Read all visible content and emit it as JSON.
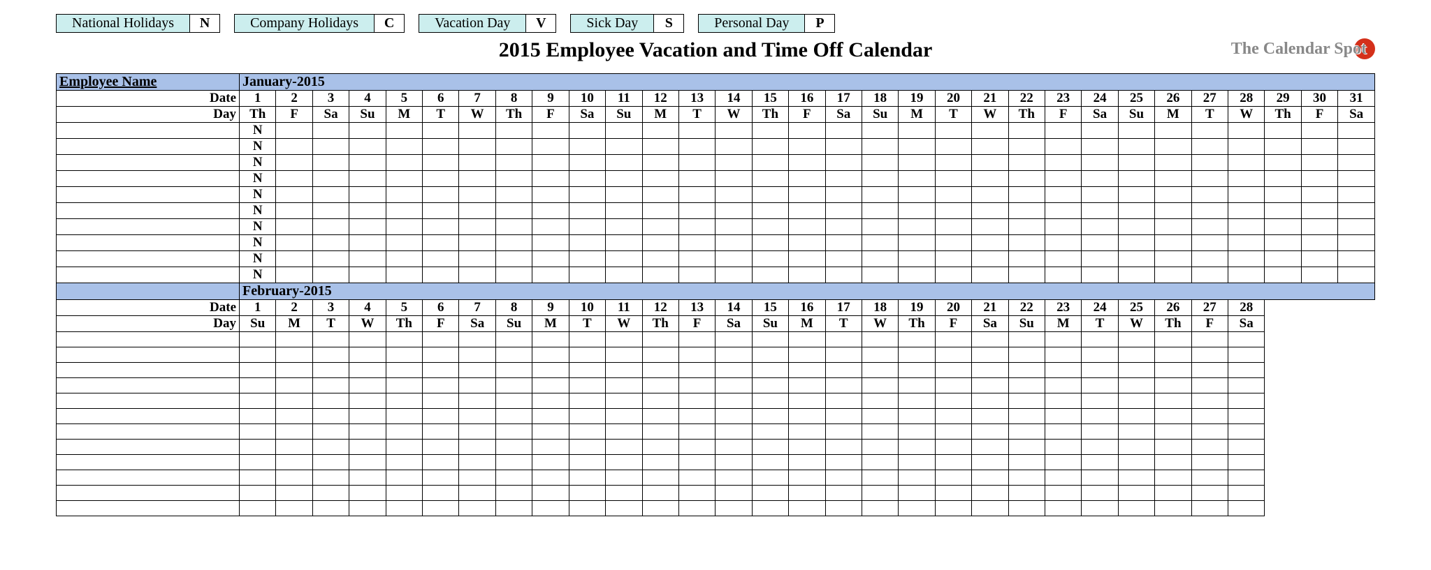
{
  "legend": [
    {
      "label": "National Holidays",
      "code": "N"
    },
    {
      "label": "Company Holidays",
      "code": "C"
    },
    {
      "label": "Vacation Day",
      "code": "V"
    },
    {
      "label": "Sick Day",
      "code": "S"
    },
    {
      "label": "Personal Day",
      "code": "P"
    }
  ],
  "title": "2015 Employee Vacation and Time Off Calendar",
  "brand": "The Calendar Spot",
  "emp_header": "Employee Name",
  "row_date": "Date",
  "row_day": "Day",
  "months": [
    {
      "name": "January-2015",
      "num_days": 31,
      "dates": [
        "1",
        "2",
        "3",
        "4",
        "5",
        "6",
        "7",
        "8",
        "9",
        "10",
        "11",
        "12",
        "13",
        "14",
        "15",
        "16",
        "17",
        "18",
        "19",
        "20",
        "21",
        "22",
        "23",
        "24",
        "25",
        "26",
        "27",
        "28",
        "29",
        "30",
        "31"
      ],
      "days": [
        "Th",
        "F",
        "Sa",
        "Su",
        "M",
        "T",
        "W",
        "Th",
        "F",
        "Sa",
        "Su",
        "M",
        "T",
        "W",
        "Th",
        "F",
        "Sa",
        "Su",
        "M",
        "T",
        "W",
        "Th",
        "F",
        "Sa",
        "Su",
        "M",
        "T",
        "W",
        "Th",
        "F",
        "Sa"
      ],
      "employees": [
        {
          "name": "",
          "entries": [
            "N",
            "",
            "",
            "",
            "",
            "",
            "",
            "",
            "",
            "",
            "",
            "",
            "",
            "",
            "",
            "",
            "",
            "",
            "",
            "",
            "",
            "",
            "",
            "",
            "",
            "",
            "",
            "",
            "",
            "",
            ""
          ]
        },
        {
          "name": "",
          "entries": [
            "N",
            "",
            "",
            "",
            "",
            "",
            "",
            "",
            "",
            "",
            "",
            "",
            "",
            "",
            "",
            "",
            "",
            "",
            "",
            "",
            "",
            "",
            "",
            "",
            "",
            "",
            "",
            "",
            "",
            "",
            ""
          ]
        },
        {
          "name": "",
          "entries": [
            "N",
            "",
            "",
            "",
            "",
            "",
            "",
            "",
            "",
            "",
            "",
            "",
            "",
            "",
            "",
            "",
            "",
            "",
            "",
            "",
            "",
            "",
            "",
            "",
            "",
            "",
            "",
            "",
            "",
            "",
            ""
          ]
        },
        {
          "name": "",
          "entries": [
            "N",
            "",
            "",
            "",
            "",
            "",
            "",
            "",
            "",
            "",
            "",
            "",
            "",
            "",
            "",
            "",
            "",
            "",
            "",
            "",
            "",
            "",
            "",
            "",
            "",
            "",
            "",
            "",
            "",
            "",
            ""
          ]
        },
        {
          "name": "",
          "entries": [
            "N",
            "",
            "",
            "",
            "",
            "",
            "",
            "",
            "",
            "",
            "",
            "",
            "",
            "",
            "",
            "",
            "",
            "",
            "",
            "",
            "",
            "",
            "",
            "",
            "",
            "",
            "",
            "",
            "",
            "",
            ""
          ]
        },
        {
          "name": "",
          "entries": [
            "N",
            "",
            "",
            "",
            "",
            "",
            "",
            "",
            "",
            "",
            "",
            "",
            "",
            "",
            "",
            "",
            "",
            "",
            "",
            "",
            "",
            "",
            "",
            "",
            "",
            "",
            "",
            "",
            "",
            "",
            ""
          ]
        },
        {
          "name": "",
          "entries": [
            "N",
            "",
            "",
            "",
            "",
            "",
            "",
            "",
            "",
            "",
            "",
            "",
            "",
            "",
            "",
            "",
            "",
            "",
            "",
            "",
            "",
            "",
            "",
            "",
            "",
            "",
            "",
            "",
            "",
            "",
            ""
          ]
        },
        {
          "name": "",
          "entries": [
            "N",
            "",
            "",
            "",
            "",
            "",
            "",
            "",
            "",
            "",
            "",
            "",
            "",
            "",
            "",
            "",
            "",
            "",
            "",
            "",
            "",
            "",
            "",
            "",
            "",
            "",
            "",
            "",
            "",
            "",
            ""
          ]
        },
        {
          "name": "",
          "entries": [
            "N",
            "",
            "",
            "",
            "",
            "",
            "",
            "",
            "",
            "",
            "",
            "",
            "",
            "",
            "",
            "",
            "",
            "",
            "",
            "",
            "",
            "",
            "",
            "",
            "",
            "",
            "",
            "",
            "",
            "",
            ""
          ]
        },
        {
          "name": "",
          "entries": [
            "N",
            "",
            "",
            "",
            "",
            "",
            "",
            "",
            "",
            "",
            "",
            "",
            "",
            "",
            "",
            "",
            "",
            "",
            "",
            "",
            "",
            "",
            "",
            "",
            "",
            "",
            "",
            "",
            "",
            "",
            ""
          ]
        }
      ]
    },
    {
      "name": "February-2015",
      "num_days": 28,
      "dates": [
        "1",
        "2",
        "3",
        "4",
        "5",
        "6",
        "7",
        "8",
        "9",
        "10",
        "11",
        "12",
        "13",
        "14",
        "15",
        "16",
        "17",
        "18",
        "19",
        "20",
        "21",
        "22",
        "23",
        "24",
        "25",
        "26",
        "27",
        "28"
      ],
      "days": [
        "Su",
        "M",
        "T",
        "W",
        "Th",
        "F",
        "Sa",
        "Su",
        "M",
        "T",
        "W",
        "Th",
        "F",
        "Sa",
        "Su",
        "M",
        "T",
        "W",
        "Th",
        "F",
        "Sa",
        "Su",
        "M",
        "T",
        "W",
        "Th",
        "F",
        "Sa"
      ],
      "employees": [
        {
          "name": "",
          "entries": [
            "",
            "",
            "",
            "",
            "",
            "",
            "",
            "",
            "",
            "",
            "",
            "",
            "",
            "",
            "",
            "",
            "",
            "",
            "",
            "",
            "",
            "",
            "",
            "",
            "",
            "",
            "",
            ""
          ]
        },
        {
          "name": "",
          "entries": [
            "",
            "",
            "",
            "",
            "",
            "",
            "",
            "",
            "",
            "",
            "",
            "",
            "",
            "",
            "",
            "",
            "",
            "",
            "",
            "",
            "",
            "",
            "",
            "",
            "",
            "",
            "",
            ""
          ]
        },
        {
          "name": "",
          "entries": [
            "",
            "",
            "",
            "",
            "",
            "",
            "",
            "",
            "",
            "",
            "",
            "",
            "",
            "",
            "",
            "",
            "",
            "",
            "",
            "",
            "",
            "",
            "",
            "",
            "",
            "",
            "",
            ""
          ]
        },
        {
          "name": "",
          "entries": [
            "",
            "",
            "",
            "",
            "",
            "",
            "",
            "",
            "",
            "",
            "",
            "",
            "",
            "",
            "",
            "",
            "",
            "",
            "",
            "",
            "",
            "",
            "",
            "",
            "",
            "",
            "",
            ""
          ]
        },
        {
          "name": "",
          "entries": [
            "",
            "",
            "",
            "",
            "",
            "",
            "",
            "",
            "",
            "",
            "",
            "",
            "",
            "",
            "",
            "",
            "",
            "",
            "",
            "",
            "",
            "",
            "",
            "",
            "",
            "",
            "",
            ""
          ]
        },
        {
          "name": "",
          "entries": [
            "",
            "",
            "",
            "",
            "",
            "",
            "",
            "",
            "",
            "",
            "",
            "",
            "",
            "",
            "",
            "",
            "",
            "",
            "",
            "",
            "",
            "",
            "",
            "",
            "",
            "",
            "",
            ""
          ]
        },
        {
          "name": "",
          "entries": [
            "",
            "",
            "",
            "",
            "",
            "",
            "",
            "",
            "",
            "",
            "",
            "",
            "",
            "",
            "",
            "",
            "",
            "",
            "",
            "",
            "",
            "",
            "",
            "",
            "",
            "",
            "",
            ""
          ]
        },
        {
          "name": "",
          "entries": [
            "",
            "",
            "",
            "",
            "",
            "",
            "",
            "",
            "",
            "",
            "",
            "",
            "",
            "",
            "",
            "",
            "",
            "",
            "",
            "",
            "",
            "",
            "",
            "",
            "",
            "",
            "",
            ""
          ]
        },
        {
          "name": "",
          "entries": [
            "",
            "",
            "",
            "",
            "",
            "",
            "",
            "",
            "",
            "",
            "",
            "",
            "",
            "",
            "",
            "",
            "",
            "",
            "",
            "",
            "",
            "",
            "",
            "",
            "",
            "",
            "",
            ""
          ]
        },
        {
          "name": "",
          "entries": [
            "",
            "",
            "",
            "",
            "",
            "",
            "",
            "",
            "",
            "",
            "",
            "",
            "",
            "",
            "",
            "",
            "",
            "",
            "",
            "",
            "",
            "",
            "",
            "",
            "",
            "",
            "",
            ""
          ]
        },
        {
          "name": "",
          "entries": [
            "",
            "",
            "",
            "",
            "",
            "",
            "",
            "",
            "",
            "",
            "",
            "",
            "",
            "",
            "",
            "",
            "",
            "",
            "",
            "",
            "",
            "",
            "",
            "",
            "",
            "",
            "",
            ""
          ]
        },
        {
          "name": "",
          "entries": [
            "",
            "",
            "",
            "",
            "",
            "",
            "",
            "",
            "",
            "",
            "",
            "",
            "",
            "",
            "",
            "",
            "",
            "",
            "",
            "",
            "",
            "",
            "",
            "",
            "",
            "",
            "",
            ""
          ]
        }
      ]
    }
  ]
}
